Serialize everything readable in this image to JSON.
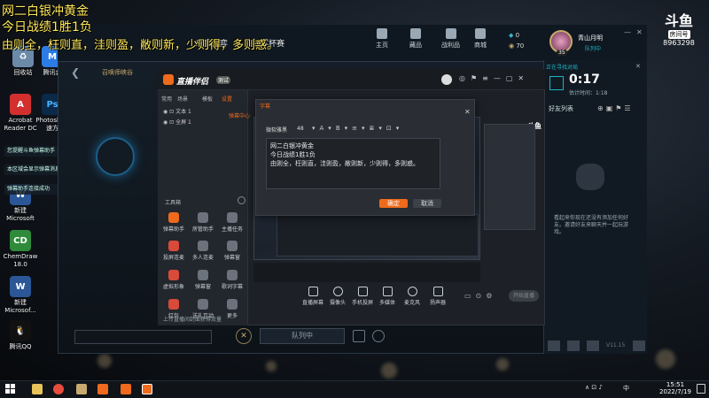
{
  "overlay": {
    "line1": "网二白银冲黄金",
    "line2": "今日战绩1胜1负",
    "line3": "由则全，枉则直，洼则盈，敝则新，少则得，多则惑。"
  },
  "douyu": {
    "logo": "斗鱼",
    "subtitle": "房间号",
    "room_id": "8963298"
  },
  "desktop_icons": [
    {
      "label": "回收站"
    },
    {
      "label": "腾讯会"
    },
    {
      "label": "Acrobat Reader DC"
    },
    {
      "label": "Photosh 快速方"
    },
    {
      "label": "新建 Microsoft"
    },
    {
      "label": "ChemDraw 18.0"
    },
    {
      "label": "新建 Microsof..."
    },
    {
      "label": "腾讯QQ"
    }
  ],
  "notifications": [
    {
      "text": "您提醒斗鱼弹幕助手"
    },
    {
      "text": "本区域会显示弹幕消息和礼物消息"
    },
    {
      "text": "弹幕助手连接成功"
    }
  ],
  "client": {
    "title": "召唤师峡谷",
    "nav": [
      "乐顶之弈",
      "冠军杯赛",
      "主页",
      "藏品",
      "战利品",
      "商城"
    ],
    "currency": {
      "be": "0",
      "rp": "70"
    },
    "player": {
      "name": "青山月明",
      "status": "队列中",
      "level": "35"
    },
    "queue": {
      "label": "正在寻找对局",
      "time": "0:17",
      "estimate": "估计时间：",
      "estimate_value": "1:18"
    },
    "friends": {
      "header": "好友列表"
    },
    "friends_empty": "看起来你现在还没有添加任何好友。邀请好友来聊天并一起玩游戏。",
    "queue_button": "队列中",
    "version": "V11.15"
  },
  "app": {
    "title": "直播伴侣",
    "badge": "测试",
    "menu": [
      "常用",
      "场景",
      "模板",
      "设置"
    ],
    "scene_items": [
      "文本 1",
      "全屏 1"
    ],
    "tools_label": "工具箱",
    "sidebar_tab": "弹幕中心",
    "grid": [
      {
        "label": "弹幕助手"
      },
      {
        "label": "房管助手"
      },
      {
        "label": "主播任务"
      },
      {
        "label": "投屏连麦"
      },
      {
        "label": "多人连麦"
      },
      {
        "label": "弹幕窗"
      },
      {
        "label": "虚拟形象"
      },
      {
        "label": "弹幕窗"
      },
      {
        "label": "歌词字幕"
      },
      {
        "label": "红包"
      },
      {
        "label": "送礼互动"
      },
      {
        "label": "更多"
      }
    ],
    "footer_notice": "上传直播间封面获得流量",
    "toolbar": [
      {
        "label": "直播屏幕"
      },
      {
        "label": "摄像头"
      },
      {
        "label": "手机投屏"
      },
      {
        "label": "多媒体"
      },
      {
        "label": "麦克风"
      },
      {
        "label": "扬声器"
      }
    ],
    "start_button": "开始直播"
  },
  "dialog": {
    "title": "字幕",
    "font": "微软雅黑",
    "size": "48",
    "text_line1": "网二白银冲黄金",
    "text_line2": "今日战绩1胜1负",
    "text_line3": "由则全，枉则直，洼则盈，敝则新，少则得，多则惑。",
    "ok": "确定",
    "cancel": "取消"
  },
  "taskbar": {
    "time": "15:51",
    "date": "2022/7/19",
    "ime": "中"
  },
  "colors": {
    "accent_orange": "#ef6a1c",
    "overlay_yellow": "#ffe95a",
    "client_teal": "#1fb2c9"
  }
}
